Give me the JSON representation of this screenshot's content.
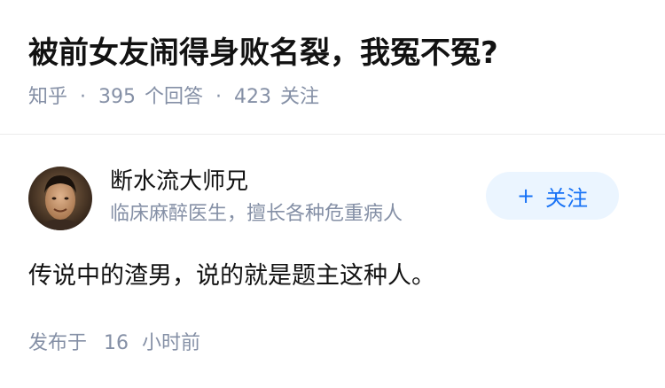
{
  "question": {
    "title": "被前女友闹得身败名裂，我冤不冤?",
    "source": "知乎",
    "separator": "·",
    "answers_count": "395",
    "answers_label": "个回答",
    "followers_count": "423",
    "followers_label": "关注"
  },
  "answer": {
    "author": {
      "name": "断水流大师兄",
      "bio": "临床麻醉医生，擅长各种危重病人"
    },
    "follow_button": {
      "icon": "plus-icon",
      "label": "关注"
    },
    "content": "传说中的渣男，说的就是题主这种人。",
    "published": {
      "prefix": "发布于",
      "number": "16",
      "unit": "小时前"
    }
  },
  "colors": {
    "title": "#121212",
    "meta": "#8590a6",
    "accent": "#1772f6",
    "button_bg": "#ebf5ff",
    "divider": "#ebebeb"
  }
}
